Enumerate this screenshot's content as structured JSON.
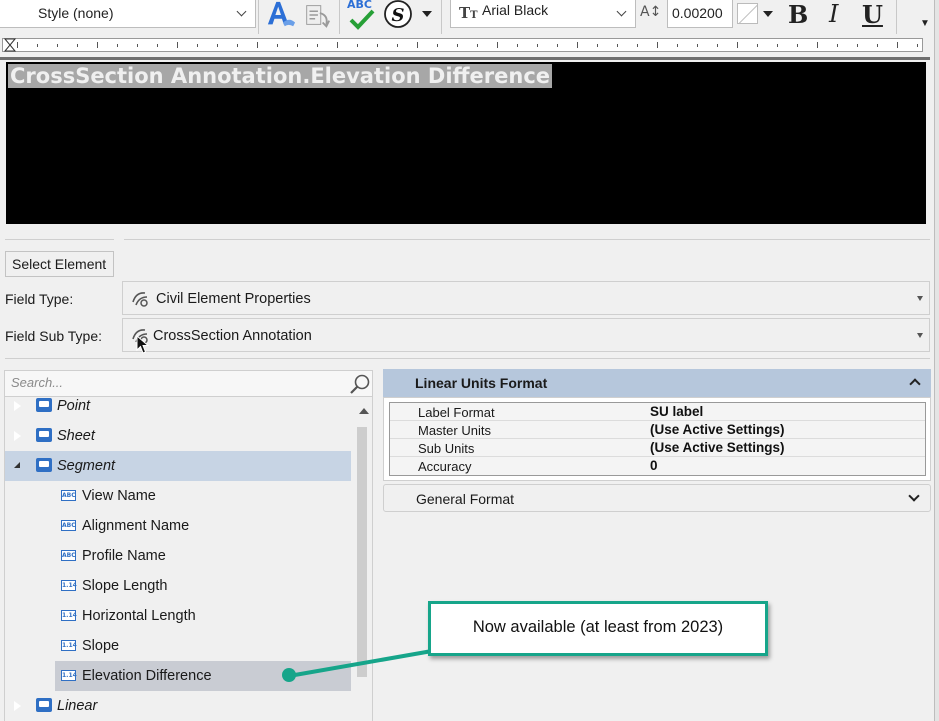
{
  "toolbar": {
    "style_value": "Style (none)",
    "font_value": "Arial Black",
    "text_height": "0.00200",
    "spell_icon_text": "ABC",
    "bold_label": "B",
    "italic_label": "I",
    "underline_label": "U"
  },
  "editor": {
    "text": "CrossSection Annotation.Elevation Difference"
  },
  "field": {
    "select_element_label": "Select Element",
    "type_label": "Field Type:",
    "type_value": "Civil Element Properties",
    "subtype_label": "Field Sub Type:",
    "subtype_value": "CrossSection Annotation"
  },
  "search": {
    "placeholder": "Search..."
  },
  "tree": {
    "categories": {
      "point": "Point",
      "sheet": "Sheet",
      "segment": "Segment",
      "linear": "Linear"
    },
    "segment_items": [
      {
        "label": "View Name",
        "icon": "ABC"
      },
      {
        "label": "Alignment Name",
        "icon": "ABC"
      },
      {
        "label": "Profile Name",
        "icon": "ABC"
      },
      {
        "label": "Slope Length",
        "icon": "1.14"
      },
      {
        "label": "Horizontal Length",
        "icon": "1.14"
      },
      {
        "label": "Slope",
        "icon": "1.14"
      },
      {
        "label": "Elevation Difference",
        "icon": "1.14"
      }
    ]
  },
  "properties": {
    "linear_units_title": "Linear Units Format",
    "rows": [
      {
        "key": "Label Format",
        "value": "SU label"
      },
      {
        "key": "Master Units",
        "value": "(Use Active Settings)"
      },
      {
        "key": "Sub Units",
        "value": "(Use Active Settings)"
      },
      {
        "key": "Accuracy",
        "value": "0"
      }
    ],
    "general_format_title": "General Format"
  },
  "callout": {
    "text": "Now available (at least from 2023)"
  },
  "colors": {
    "accent_teal": "#16a58a",
    "selection_blue": "#c7d4e4",
    "section_header": "#b6c7dc",
    "editor_bg": "#000000"
  }
}
